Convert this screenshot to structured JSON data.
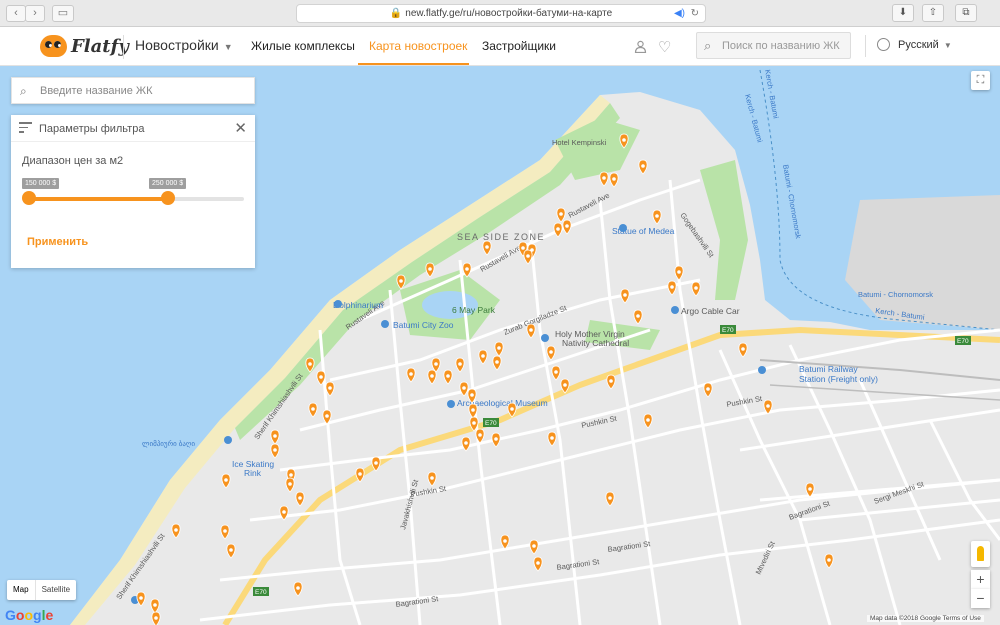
{
  "browser": {
    "url_domain": "new.flatfy.ge",
    "url_path": "/ru/новостройки-батуми-на-карте"
  },
  "header": {
    "logo_text": "Flatfy",
    "main_menu": "Новостройки",
    "nav": [
      "Жилые комплексы",
      "Карта новостроек",
      "Застройщики"
    ],
    "active_nav_index": 1,
    "search_placeholder": "Поиск по названию ЖК",
    "language": "Русский"
  },
  "map_search": {
    "placeholder": "Введите название ЖК"
  },
  "filter": {
    "title": "Параметры фильтра",
    "range_label": "Диапазон цен за м2",
    "min_price": "150 000 $",
    "max_price": "250 000 $",
    "apply": "Применить"
  },
  "map_labels": {
    "hotel": "Hotel Kempinski",
    "rustaveli": "Rustaveli Ave",
    "rustaveli2": "Rustaveli Ave",
    "gogebashvili": "Gogebashvili St",
    "seaside": "SEA SIDE ZONE",
    "medea": "Statue of Medea",
    "dolphinarium": "Dolphinarium",
    "may6": "6 May Park",
    "zoo": "Batumi City Zoo",
    "zurab": "Zurab Gorgiladze St",
    "cathedral1": "Holy Mother Virgin",
    "cathedral2": "Nativity Cathedral",
    "argo": "Argo Cable Car",
    "railway1": "Batumi Railway",
    "railway2": "Station (Freight only)",
    "museum": "Archaeological Museum",
    "pushkin1": "Pushkin St",
    "pushkin2": "Pushkin St",
    "pushkin3": "Pushkin St",
    "bagrationi1": "Bagrationi St",
    "bagrationi2": "Bagrationi St",
    "bagrationi3": "Bagrationi St",
    "meskhi": "Sergi Meskhi St",
    "iceskating1": "Ice Skating",
    "iceskating2": "Rink",
    "georgian": "ლიმპიური ბაღი",
    "kerch1": "Kerch - Batumi",
    "kerch2": "Batumi - Chornomorsk",
    "kerch3": "Kerch - Batumi",
    "chornomorsk": "Batumi - Chornomorsk",
    "kerch4": "Kerch - Batumi",
    "khimshiashvili": "Sherif Khimshiashvili St",
    "javakhishvili": "Javakhishvili St",
    "e70a": "E70",
    "e70b": "E70",
    "e70c": "E70",
    "e70d": "E70",
    "mtvedri": "Mtvediri St"
  },
  "map_controls": {
    "map": "Map",
    "satellite": "Satellite",
    "zoom_in": "+",
    "zoom_out": "−",
    "attribution": "Map data ©2018 Google   Terms of Use",
    "google": [
      "G",
      "o",
      "o",
      "g",
      "l",
      "e"
    ]
  },
  "colors": {
    "accent": "#f7931e",
    "water": "#a9d4f5",
    "park": "#b9e3a8",
    "beach": "#f4ecc0"
  }
}
